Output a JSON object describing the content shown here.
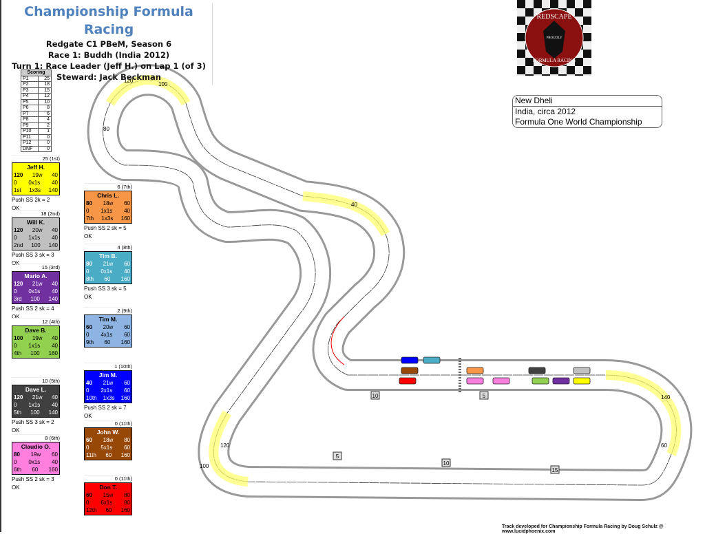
{
  "header": {
    "title": "Championship Formula Racing",
    "lines": [
      "Redgate C1 PBeM, Season 6",
      "Race 1: Buddh (India 2012)",
      "Turn 1: Race Leader (Jeff H.) on Lap 1 (of 3)",
      "Steward: Jack Beckman"
    ]
  },
  "scoring": {
    "title": "Scoring",
    "rows": [
      [
        "P1",
        "25"
      ],
      [
        "P2",
        "18"
      ],
      [
        "P3",
        "15"
      ],
      [
        "P4",
        "12"
      ],
      [
        "P5",
        "10"
      ],
      [
        "P6",
        "8"
      ],
      [
        "P7",
        "6"
      ],
      [
        "P8",
        "4"
      ],
      [
        "P9",
        "2"
      ],
      [
        "P10",
        "1"
      ],
      [
        "P11",
        "0"
      ],
      [
        "P12",
        "0"
      ],
      [
        "DNF",
        "0"
      ]
    ]
  },
  "drivers": [
    {
      "pts": "25 (1st)",
      "name": "Jeff H.",
      "r1": [
        "120",
        "19w",
        "40"
      ],
      "r2": [
        "0",
        "0x1s",
        "40"
      ],
      "r3": [
        "1st",
        "1x3s",
        "140"
      ],
      "push": "Push SS 2k = 2",
      "status": "OK",
      "color": "#ffff00",
      "text": "#000"
    },
    {
      "pts": "18 (2nd)",
      "name": "Will K.",
      "r1": [
        "120",
        "20w",
        "40"
      ],
      "r2": [
        "0",
        "1x1s",
        "40"
      ],
      "r3": [
        "2nd",
        "100",
        "140"
      ],
      "push": "Push SS 3 sk = 3",
      "status": "OK",
      "color": "#c0c0c0",
      "text": "#000"
    },
    {
      "pts": "15 (3rd)",
      "name": "Mario A.",
      "r1": [
        "120",
        "21w",
        "40"
      ],
      "r2": [
        "0",
        "0x1s",
        "40"
      ],
      "r3": [
        "3rd",
        "100",
        "140"
      ],
      "push": "Push SS 2 sk = 4",
      "status": "OK",
      "color": "#7030a0",
      "text": "#fff"
    },
    {
      "pts": "12 (4th)",
      "name": "Dave B.",
      "r1": [
        "100",
        "19w",
        "40"
      ],
      "r2": [
        "0",
        "1x1s",
        "40"
      ],
      "r3": [
        "4th",
        "100",
        "160"
      ],
      "push": "",
      "status": "",
      "color": "#92d050",
      "text": "#000"
    },
    {
      "pts": "10 (5th)",
      "name": "Dave L.",
      "r1": [
        "120",
        "21w",
        "40"
      ],
      "r2": [
        "0",
        "1x1s",
        "40"
      ],
      "r3": [
        "5th",
        "100",
        "140"
      ],
      "push": "Push SS 3 sk = 2",
      "status": "OK",
      "color": "#404040",
      "text": "#fff"
    },
    {
      "pts": "8 (6th)",
      "name": "Claudio O.",
      "r1": [
        "80",
        "19w",
        "60"
      ],
      "r2": [
        "0",
        "0x1s",
        "40"
      ],
      "r3": [
        "6th",
        "60",
        "160"
      ],
      "push": "Push SS 2 sk = 3",
      "status": "OK",
      "color": "#ff7fdf",
      "text": "#000"
    },
    {
      "pts": "6 (7th)",
      "name": "Chris L.",
      "r1": [
        "80",
        "18w",
        "60"
      ],
      "r2": [
        "0",
        "1x1s",
        "40"
      ],
      "r3": [
        "7th",
        "1x3s",
        "160"
      ],
      "push": "Push SS 2 sk = 5",
      "status": "OK",
      "color": "#f79646",
      "text": "#000"
    },
    {
      "pts": "4 (8th)",
      "name": "Tim B.",
      "r1": [
        "80",
        "21w",
        "60"
      ],
      "r2": [
        "0",
        "0x1s",
        "40"
      ],
      "r3": [
        "8th",
        "60",
        "160"
      ],
      "push": "Push SS 3 sk = 5",
      "status": "OK",
      "color": "#4bacc6",
      "text": "#fff"
    },
    {
      "pts": "2 (9th)",
      "name": "Tim M.",
      "r1": [
        "60",
        "20w",
        "60"
      ],
      "r2": [
        "0",
        "4x1s",
        "60"
      ],
      "r3": [
        "9th",
        "60",
        "160"
      ],
      "push": "",
      "status": "",
      "color": "#8db4e2",
      "text": "#000"
    },
    {
      "pts": "1 (10th)",
      "name": "Jim M.",
      "r1": [
        "40",
        "21w",
        "60"
      ],
      "r2": [
        "0",
        "2x1s",
        "60"
      ],
      "r3": [
        "10th",
        "1x3s",
        "160"
      ],
      "push": "Push SS 2 sk = 7",
      "status": "OK",
      "color": "#0000ff",
      "text": "#fff"
    },
    {
      "pts": "0 (11th)",
      "name": "John W.",
      "r1": [
        "60",
        "18w",
        "80"
      ],
      "r2": [
        "0",
        "5x1s",
        "60"
      ],
      "r3": [
        "11th",
        "60",
        "160"
      ],
      "push": "",
      "status": "",
      "color": "#974706",
      "text": "#fff"
    },
    {
      "pts": "0 (11th)",
      "name": "Don T.",
      "r1": [
        "60",
        "15w",
        "80"
      ],
      "r2": [
        "0",
        "6x1s",
        "80"
      ],
      "r3": [
        "12th",
        "60",
        "160"
      ],
      "push": "",
      "status": "",
      "color": "#ff0000",
      "text": "#000"
    }
  ],
  "logo": {
    "top": "REDSCAPE",
    "middle": "PROUDLY CRASHING RACE CARS SINCE 2016",
    "bottom": "FORMULA RACING"
  },
  "track_info": {
    "name": "New Dheli",
    "lines": [
      "India, circa 2012",
      "Formula One World Championship"
    ]
  },
  "track": {
    "markers": [
      "5",
      "10",
      "15",
      "5",
      "10"
    ],
    "speed_labels": [
      "120",
      "100",
      "80",
      "140",
      "60",
      "40"
    ]
  },
  "credit": "Track developed for Championship Formula Racing by Doug Schulz @ www.lucidphoenix.com"
}
